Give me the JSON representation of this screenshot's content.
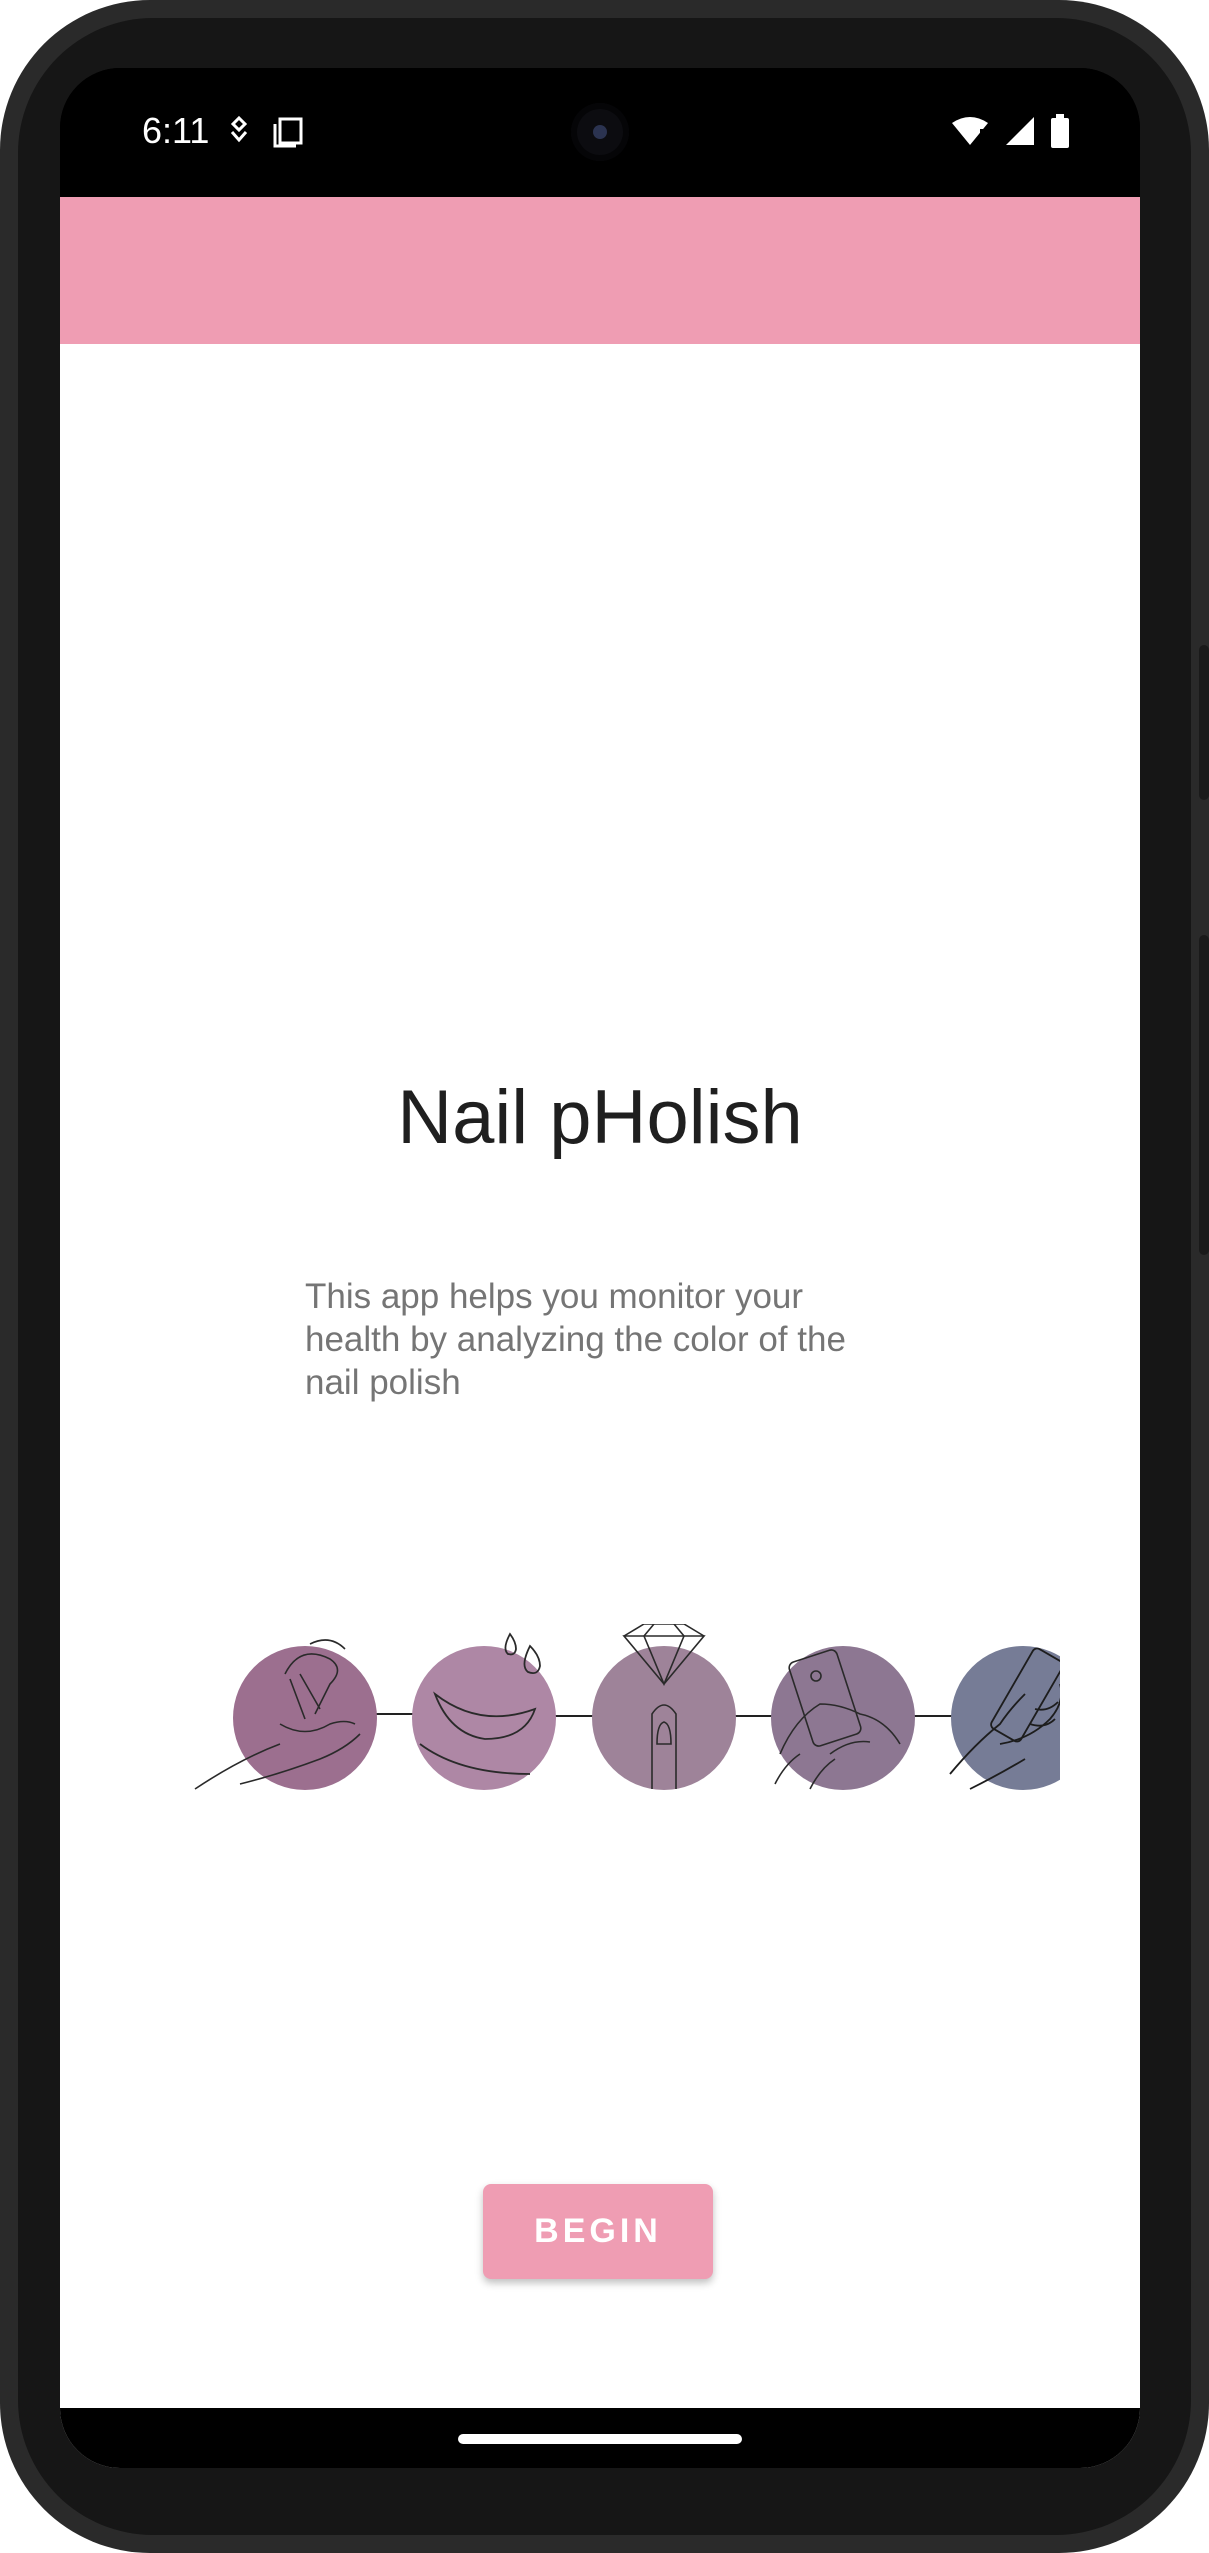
{
  "status_bar": {
    "time": "6:11"
  },
  "app": {
    "title": "Nail pHolish",
    "description": "This app helps you monitor your health by analyzing the color of the nail polish",
    "begin_label": "BEGIN"
  },
  "steps": [
    {
      "icon": "apply-polish-icon",
      "color": "#9c6f8f"
    },
    {
      "icon": "water-drops-icon",
      "color": "#ae87a5"
    },
    {
      "icon": "crystal-nail-icon",
      "color": "#9e8399"
    },
    {
      "icon": "phone-scan-icon",
      "color": "#8d7792"
    },
    {
      "icon": "hand-phone-icon",
      "color": "#767c96"
    }
  ],
  "colors": {
    "accent": "#ef9db3",
    "title": "#1f1f1f",
    "description": "#757575"
  }
}
